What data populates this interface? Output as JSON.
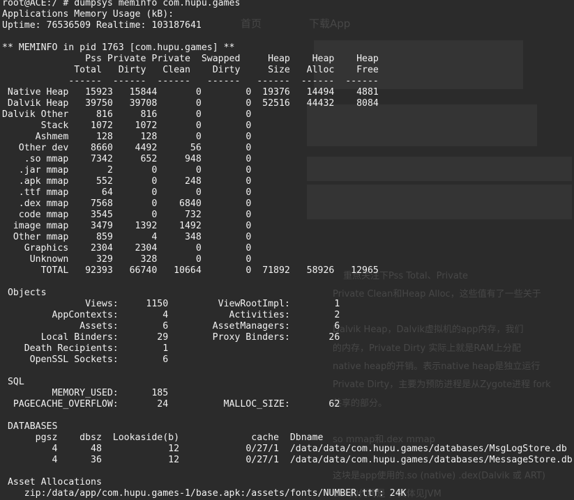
{
  "bg_page": {
    "nav": [
      "首页",
      "下载App"
    ],
    "paragraphs": [
      "重点关注下Pss Total、Private",
      "Private Clean和Heap Alloc，这些值有了一些关于",
      "Dalvik Heap，Dalvik虚拟机的app内存，我们",
      "的内存，Private Dirty 实际上就是RAM上分配",
      "native heap的开销。表示native heap是独立运行",
      "Private Dirty，主要为预防进程是从Zygote进程 fork",
      "共享的部分。",
      "so mmap和.dex mmap",
      "这块是app使用的.so (native) .dex(Dalvik 或 ART)",
      "dex的代码是 ，具体见JVM"
    ]
  },
  "terminal": {
    "lines": [
      [
        {
          "t": "root@ACE:/ # dumpsys meminfo com.hupu.games",
          "w": 0
        }
      ],
      [
        {
          "t": "Applications Memory Usage (kB):",
          "w": 0
        }
      ],
      [
        {
          "t": "Uptime: 76536509 Realtime: 103187641",
          "w": 0
        }
      ],
      [],
      [
        {
          "t": "** MEMINFO in pid 1763 [com.hupu.games] **",
          "w": 0
        }
      ],
      [
        {
          "t": "",
          "w": 10,
          "a": "r"
        },
        {
          "t": "Pss",
          "w": 8,
          "a": "r"
        },
        {
          "t": "Private",
          "w": 8,
          "a": "r"
        },
        {
          "t": "Private",
          "w": 8,
          "a": "r"
        },
        {
          "t": "Swapped",
          "w": 9,
          "a": "r"
        },
        {
          "t": "Heap",
          "w": 9,
          "a": "r"
        },
        {
          "t": "Heap",
          "w": 8,
          "a": "r"
        },
        {
          "t": "Heap",
          "w": 8,
          "a": "r"
        }
      ],
      [
        {
          "t": "",
          "w": 10,
          "a": "r"
        },
        {
          "t": "Total",
          "w": 8,
          "a": "r"
        },
        {
          "t": "Dirty",
          "w": 8,
          "a": "r"
        },
        {
          "t": "Clean",
          "w": 8,
          "a": "r"
        },
        {
          "t": "Dirty",
          "w": 9,
          "a": "r"
        },
        {
          "t": "Size",
          "w": 9,
          "a": "r"
        },
        {
          "t": "Alloc",
          "w": 8,
          "a": "r"
        },
        {
          "t": "Free",
          "w": 8,
          "a": "r"
        }
      ],
      [
        {
          "t": "",
          "w": 10,
          "a": "r"
        },
        {
          "t": "------",
          "w": 8,
          "a": "r"
        },
        {
          "t": "------",
          "w": 8,
          "a": "r"
        },
        {
          "t": "------",
          "w": 8,
          "a": "r"
        },
        {
          "t": "------",
          "w": 9,
          "a": "r"
        },
        {
          "t": "------",
          "w": 9,
          "a": "r"
        },
        {
          "t": "------",
          "w": 8,
          "a": "r"
        },
        {
          "t": "------",
          "w": 8,
          "a": "r"
        }
      ],
      [
        {
          "t": "Native Heap",
          "w": 12,
          "a": "r"
        },
        {
          "t": "15923",
          "w": 8,
          "a": "r"
        },
        {
          "t": "15844",
          "w": 8,
          "a": "r"
        },
        {
          "t": "0",
          "w": 8,
          "a": "r"
        },
        {
          "t": "0",
          "w": 9,
          "a": "r"
        },
        {
          "t": "19376",
          "w": 7,
          "a": "r"
        },
        {
          "t": "14494",
          "w": 8,
          "a": "r"
        },
        {
          "t": "4881",
          "w": 8,
          "a": "r"
        }
      ],
      [
        {
          "t": "Dalvik Heap",
          "w": 12,
          "a": "r"
        },
        {
          "t": "39750",
          "w": 8,
          "a": "r"
        },
        {
          "t": "39708",
          "w": 8,
          "a": "r"
        },
        {
          "t": "0",
          "w": 8,
          "a": "r"
        },
        {
          "t": "0",
          "w": 9,
          "a": "r"
        },
        {
          "t": "52516",
          "w": 7,
          "a": "r"
        },
        {
          "t": "44432",
          "w": 8,
          "a": "r"
        },
        {
          "t": "8084",
          "w": 8,
          "a": "r"
        }
      ],
      [
        {
          "t": "Dalvik Other",
          "w": 12,
          "a": "r"
        },
        {
          "t": "816",
          "w": 8,
          "a": "r"
        },
        {
          "t": "816",
          "w": 8,
          "a": "r"
        },
        {
          "t": "0",
          "w": 8,
          "a": "r"
        },
        {
          "t": "0",
          "w": 9,
          "a": "r"
        }
      ],
      [
        {
          "t": "Stack",
          "w": 12,
          "a": "r"
        },
        {
          "t": "1072",
          "w": 8,
          "a": "r"
        },
        {
          "t": "1072",
          "w": 8,
          "a": "r"
        },
        {
          "t": "0",
          "w": 8,
          "a": "r"
        },
        {
          "t": "0",
          "w": 9,
          "a": "r"
        }
      ],
      [
        {
          "t": "Ashmem",
          "w": 12,
          "a": "r"
        },
        {
          "t": "128",
          "w": 8,
          "a": "r"
        },
        {
          "t": "128",
          "w": 8,
          "a": "r"
        },
        {
          "t": "0",
          "w": 8,
          "a": "r"
        },
        {
          "t": "0",
          "w": 9,
          "a": "r"
        }
      ],
      [
        {
          "t": "Other dev",
          "w": 12,
          "a": "r"
        },
        {
          "t": "8660",
          "w": 8,
          "a": "r"
        },
        {
          "t": "4492",
          "w": 8,
          "a": "r"
        },
        {
          "t": "56",
          "w": 8,
          "a": "r"
        },
        {
          "t": "0",
          "w": 9,
          "a": "r"
        }
      ],
      [
        {
          "t": ".so mmap",
          "w": 12,
          "a": "r"
        },
        {
          "t": "7342",
          "w": 8,
          "a": "r"
        },
        {
          "t": "652",
          "w": 8,
          "a": "r"
        },
        {
          "t": "948",
          "w": 8,
          "a": "r"
        },
        {
          "t": "0",
          "w": 9,
          "a": "r"
        }
      ],
      [
        {
          "t": ".jar mmap",
          "w": 12,
          "a": "r"
        },
        {
          "t": "2",
          "w": 8,
          "a": "r"
        },
        {
          "t": "0",
          "w": 8,
          "a": "r"
        },
        {
          "t": "0",
          "w": 8,
          "a": "r"
        },
        {
          "t": "0",
          "w": 9,
          "a": "r"
        }
      ],
      [
        {
          "t": ".apk mmap",
          "w": 12,
          "a": "r"
        },
        {
          "t": "552",
          "w": 8,
          "a": "r"
        },
        {
          "t": "0",
          "w": 8,
          "a": "r"
        },
        {
          "t": "248",
          "w": 8,
          "a": "r"
        },
        {
          "t": "0",
          "w": 9,
          "a": "r"
        }
      ],
      [
        {
          "t": ".ttf mmap",
          "w": 12,
          "a": "r"
        },
        {
          "t": "64",
          "w": 8,
          "a": "r"
        },
        {
          "t": "0",
          "w": 8,
          "a": "r"
        },
        {
          "t": "0",
          "w": 8,
          "a": "r"
        },
        {
          "t": "0",
          "w": 9,
          "a": "r"
        }
      ],
      [
        {
          "t": ".dex mmap",
          "w": 12,
          "a": "r"
        },
        {
          "t": "7568",
          "w": 8,
          "a": "r"
        },
        {
          "t": "0",
          "w": 8,
          "a": "r"
        },
        {
          "t": "6840",
          "w": 8,
          "a": "r"
        },
        {
          "t": "0",
          "w": 9,
          "a": "r"
        }
      ],
      [
        {
          "t": "code mmap",
          "w": 12,
          "a": "r"
        },
        {
          "t": "3545",
          "w": 8,
          "a": "r"
        },
        {
          "t": "0",
          "w": 8,
          "a": "r"
        },
        {
          "t": "732",
          "w": 8,
          "a": "r"
        },
        {
          "t": "0",
          "w": 9,
          "a": "r"
        }
      ],
      [
        {
          "t": "image mmap",
          "w": 12,
          "a": "r"
        },
        {
          "t": "3479",
          "w": 8,
          "a": "r"
        },
        {
          "t": "1392",
          "w": 8,
          "a": "r"
        },
        {
          "t": "1492",
          "w": 8,
          "a": "r"
        },
        {
          "t": "0",
          "w": 9,
          "a": "r"
        }
      ],
      [
        {
          "t": "Other mmap",
          "w": 12,
          "a": "r"
        },
        {
          "t": "859",
          "w": 8,
          "a": "r"
        },
        {
          "t": "4",
          "w": 8,
          "a": "r"
        },
        {
          "t": "348",
          "w": 8,
          "a": "r"
        },
        {
          "t": "0",
          "w": 9,
          "a": "r"
        }
      ],
      [
        {
          "t": "Graphics",
          "w": 12,
          "a": "r"
        },
        {
          "t": "2304",
          "w": 8,
          "a": "r"
        },
        {
          "t": "2304",
          "w": 8,
          "a": "r"
        },
        {
          "t": "0",
          "w": 8,
          "a": "r"
        },
        {
          "t": "0",
          "w": 9,
          "a": "r"
        }
      ],
      [
        {
          "t": "Unknown",
          "w": 12,
          "a": "r"
        },
        {
          "t": "329",
          "w": 8,
          "a": "r"
        },
        {
          "t": "328",
          "w": 8,
          "a": "r"
        },
        {
          "t": "0",
          "w": 8,
          "a": "r"
        },
        {
          "t": "0",
          "w": 9,
          "a": "r"
        }
      ],
      [
        {
          "t": "TOTAL",
          "w": 12,
          "a": "r"
        },
        {
          "t": "92393",
          "w": 8,
          "a": "r"
        },
        {
          "t": "66740",
          "w": 8,
          "a": "r"
        },
        {
          "t": "10664",
          "w": 8,
          "a": "r"
        },
        {
          "t": "0",
          "w": 9,
          "a": "r"
        },
        {
          "t": "71892",
          "w": 7,
          "a": "r"
        },
        {
          "t": "58926",
          "w": 8,
          "a": "r"
        },
        {
          "t": "12965",
          "w": 8,
          "a": "r"
        }
      ],
      [],
      [
        {
          "t": "Objects",
          "w": 0,
          "a": "l",
          "p": 1
        }
      ],
      [
        {
          "t": "Views:",
          "w": 21,
          "a": "r"
        },
        {
          "t": "1150",
          "w": 9,
          "a": "r"
        },
        {
          "t": "ViewRootImpl:",
          "w": 22,
          "a": "r"
        },
        {
          "t": "1",
          "w": 9,
          "a": "r"
        }
      ],
      [
        {
          "t": "AppContexts:",
          "w": 21,
          "a": "r"
        },
        {
          "t": "4",
          "w": 9,
          "a": "r"
        },
        {
          "t": "Activities:",
          "w": 22,
          "a": "r"
        },
        {
          "t": "2",
          "w": 9,
          "a": "r"
        }
      ],
      [
        {
          "t": "Assets:",
          "w": 21,
          "a": "r"
        },
        {
          "t": "6",
          "w": 9,
          "a": "r"
        },
        {
          "t": "AssetManagers:",
          "w": 22,
          "a": "r"
        },
        {
          "t": "6",
          "w": 9,
          "a": "r"
        }
      ],
      [
        {
          "t": "Local Binders:",
          "w": 21,
          "a": "r"
        },
        {
          "t": "29",
          "w": 9,
          "a": "r"
        },
        {
          "t": "Proxy Binders:",
          "w": 22,
          "a": "r"
        },
        {
          "t": "26",
          "w": 9,
          "a": "r"
        }
      ],
      [
        {
          "t": "Death Recipients:",
          "w": 21,
          "a": "r"
        },
        {
          "t": "1",
          "w": 9,
          "a": "r"
        }
      ],
      [
        {
          "t": "OpenSSL Sockets:",
          "w": 21,
          "a": "r"
        },
        {
          "t": "6",
          "w": 9,
          "a": "r"
        }
      ],
      [],
      [
        {
          "t": "SQL",
          "w": 0,
          "a": "l",
          "p": 1
        }
      ],
      [
        {
          "t": "MEMORY_USED:",
          "w": 21,
          "a": "r"
        },
        {
          "t": "185",
          "w": 9,
          "a": "r"
        }
      ],
      [
        {
          "t": "PAGECACHE_OVERFLOW:",
          "w": 21,
          "a": "r"
        },
        {
          "t": "24",
          "w": 9,
          "a": "r"
        },
        {
          "t": "MALLOC_SIZE:",
          "w": 22,
          "a": "r"
        },
        {
          "t": "62",
          "w": 9,
          "a": "r"
        }
      ],
      [],
      [
        {
          "t": "DATABASES",
          "w": 0,
          "a": "l",
          "p": 1
        }
      ],
      [
        {
          "t": "pgsz",
          "w": 10,
          "a": "r"
        },
        {
          "t": "dbsz",
          "w": 8,
          "a": "r"
        },
        {
          "t": "Lookaside(b)",
          "w": 14,
          "a": "r"
        },
        {
          "t": "cache",
          "w": 18,
          "a": "r"
        },
        {
          "t": "Dbname",
          "w": 0,
          "a": "l",
          "p": 2
        }
      ],
      [
        {
          "t": "4",
          "w": 10,
          "a": "r"
        },
        {
          "t": "48",
          "w": 8,
          "a": "r"
        },
        {
          "t": "12",
          "w": 14,
          "a": "r"
        },
        {
          "t": "0/27/1",
          "w": 18,
          "a": "r"
        },
        {
          "t": "/data/data/com.hupu.games/databases/MsgLogStore.db",
          "w": 0,
          "a": "l",
          "p": 2
        }
      ],
      [
        {
          "t": "4",
          "w": 10,
          "a": "r"
        },
        {
          "t": "36",
          "w": 8,
          "a": "r"
        },
        {
          "t": "12",
          "w": 14,
          "a": "r"
        },
        {
          "t": "0/27/1",
          "w": 18,
          "a": "r"
        },
        {
          "t": "/data/data/com.hupu.games/databases/MessageStore.db",
          "w": 0,
          "a": "l",
          "p": 2
        }
      ],
      [],
      [
        {
          "t": "Asset Allocations",
          "w": 0,
          "a": "l",
          "p": 1
        }
      ],
      [
        {
          "t": "zip:/data/app/com.hupu.games-1/base.apk:/assets/fonts/NUMBER.ttf: 24K",
          "w": 0,
          "a": "l",
          "p": 4
        }
      ]
    ]
  }
}
